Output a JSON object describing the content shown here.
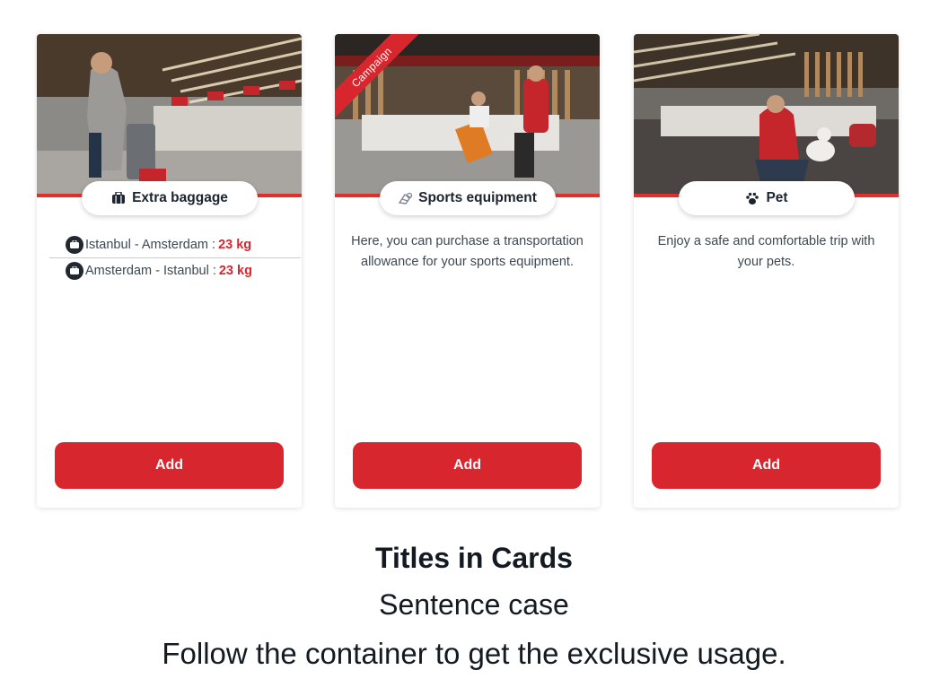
{
  "cards": [
    {
      "title": "Extra baggage",
      "title_icon": "luggage-icon",
      "campaign": null,
      "routes": [
        {
          "text": "Istanbul - Amsterdam :",
          "weight": "23 kg"
        },
        {
          "text": "Amsterdam - Istanbul :",
          "weight": "23 kg"
        }
      ],
      "button": "Add"
    },
    {
      "title": "Sports equipment",
      "title_icon": "sports-icon",
      "campaign": "Campaign",
      "description": "Here, you can purchase a transportation allowance for your sports equipment.",
      "button": "Add"
    },
    {
      "title": "Pet",
      "title_icon": "paw-icon",
      "campaign": null,
      "description": "Enjoy a safe and comfortable trip with your pets.",
      "button": "Add"
    }
  ],
  "caption": {
    "title": "Titles in Cards",
    "subtitle": "Sentence case",
    "note": "Follow the container to get the exclusive usage."
  },
  "colors": {
    "accent": "#d7262d",
    "text": "#3d4853",
    "title": "#1b2430"
  }
}
